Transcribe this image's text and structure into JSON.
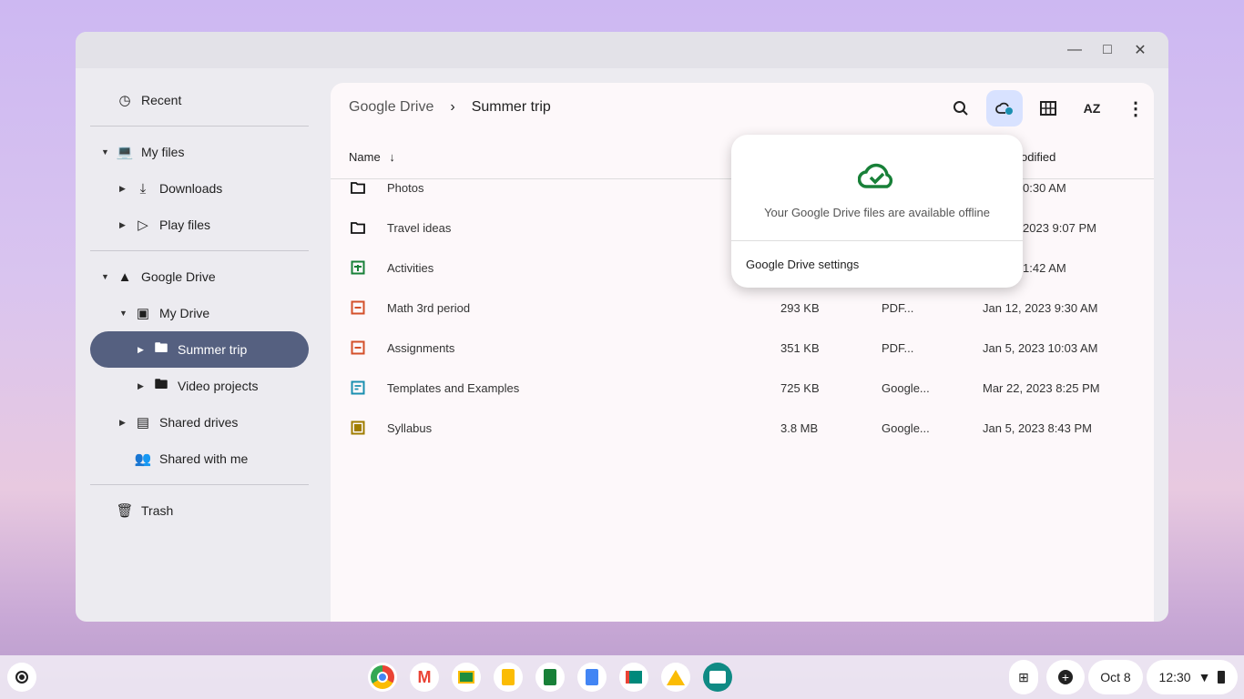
{
  "window": {
    "minimize_icon": "minimize-icon",
    "maximize_icon": "maximize-icon",
    "close_icon": "close-icon"
  },
  "sidebar": {
    "items": [
      {
        "label": "Recent",
        "icon": "clock-icon"
      },
      {
        "label": "My files",
        "icon": "laptop-icon"
      },
      {
        "label": "Downloads",
        "icon": "download-icon"
      },
      {
        "label": "Play files",
        "icon": "play-icon"
      },
      {
        "label": "Google Drive",
        "icon": "drive-icon"
      },
      {
        "label": "My Drive",
        "icon": "my-drive-icon"
      },
      {
        "label": "Summer trip",
        "icon": "folder-icon"
      },
      {
        "label": "Video projects",
        "icon": "folder-icon"
      },
      {
        "label": "Shared drives",
        "icon": "shared-drives-icon"
      },
      {
        "label": "Shared with me",
        "icon": "people-icon"
      },
      {
        "label": "Trash",
        "icon": "trash-icon"
      }
    ]
  },
  "breadcrumb": {
    "root": "Google Drive",
    "current": "Summer trip"
  },
  "toolbar": [
    "search-icon",
    "cloud-sync-icon",
    "grid-view-icon",
    "sort-az-icon",
    "more-vert-icon"
  ],
  "table": {
    "headers": {
      "name": "Name",
      "modified": "odified"
    },
    "rows": [
      {
        "name": "Photos",
        "size": "",
        "type": "",
        "modified": "0:30 AM",
        "icon": "folder"
      },
      {
        "name": "Travel ideas",
        "size": "",
        "type": "",
        "modified": "2023 9:07 PM",
        "icon": "folder"
      },
      {
        "name": "Activities",
        "size": "",
        "type": "",
        "modified": "1:42 AM",
        "icon": "sheets"
      },
      {
        "name": "Math 3rd period",
        "size": "293 KB",
        "type": "PDF...",
        "modified": "Jan 12, 2023 9:30 AM",
        "icon": "pdf"
      },
      {
        "name": "Assignments",
        "size": "351 KB",
        "type": "PDF...",
        "modified": "Jan 5, 2023 10:03 AM",
        "icon": "pdf"
      },
      {
        "name": "Templates and Examples",
        "size": "725 KB",
        "type": "Google...",
        "modified": "Mar 22, 2023 8:25 PM",
        "icon": "forms"
      },
      {
        "name": "Syllabus",
        "size": "3.8 MB",
        "type": "Google...",
        "modified": "Jan 5, 2023 8:43 PM",
        "icon": "slides"
      }
    ]
  },
  "popup": {
    "message": "Your Google Drive files are available offline",
    "settings": "Google Drive settings",
    "color": "#188038"
  },
  "taskbar": {
    "apps": [
      "Chrome",
      "Gmail",
      "Classroom",
      "Slides",
      "Sheets",
      "Docs",
      "Meet",
      "Drive",
      "Files"
    ],
    "date": "Oct 8",
    "time": "12:30"
  }
}
